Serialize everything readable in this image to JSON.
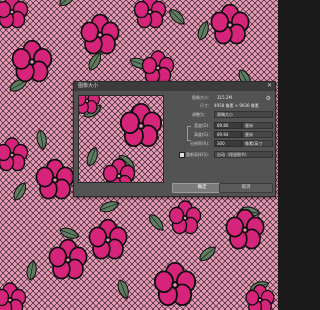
{
  "dialog": {
    "title": "图像大小",
    "image_size_label": "图像大小：",
    "image_size_value": "315.2M",
    "dimensions_label": "尺寸：",
    "dimensions_value": "4958 像素 × 9036 像素",
    "fit_label": "调整为：",
    "fit_value": "原稿大小",
    "width_label": "宽度(D)：",
    "width_value": "89.80",
    "width_unit": "厘米",
    "height_label": "高度(G)：",
    "height_value": "89.84",
    "height_unit": "厘米",
    "resolution_label": "分辨率(R)：",
    "resolution_value": "300",
    "resolution_unit": "像素/英寸",
    "resample_label": "重新采样(S)：",
    "resample_value": "自动（保留细节）",
    "ok_label": "确定",
    "cancel_label": "取消"
  },
  "colors": {
    "pattern_bg": "#e59ab6",
    "flower": "#d6247a",
    "leaf": "#5e7e62",
    "outline": "#0e0e0e",
    "dialog_bg": "#535353"
  }
}
